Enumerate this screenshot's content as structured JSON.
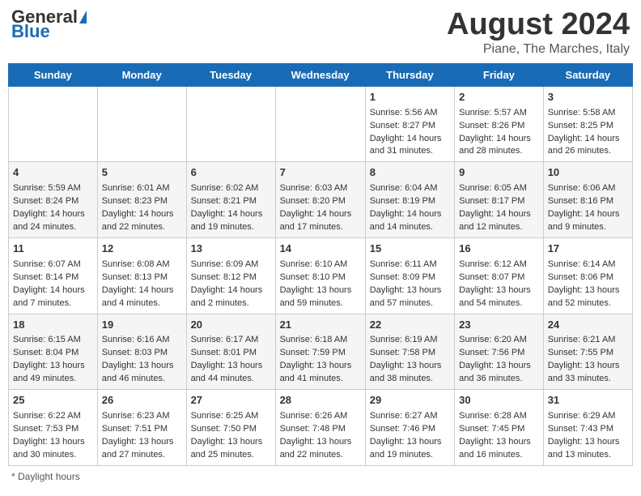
{
  "header": {
    "logo_general": "General",
    "logo_blue": "Blue",
    "month_title": "August 2024",
    "location": "Piane, The Marches, Italy"
  },
  "days_of_week": [
    "Sunday",
    "Monday",
    "Tuesday",
    "Wednesday",
    "Thursday",
    "Friday",
    "Saturday"
  ],
  "footer": {
    "daylight_label": "Daylight hours"
  },
  "weeks": [
    [
      {
        "day": "",
        "info": ""
      },
      {
        "day": "",
        "info": ""
      },
      {
        "day": "",
        "info": ""
      },
      {
        "day": "",
        "info": ""
      },
      {
        "day": "1",
        "info": "Sunrise: 5:56 AM\nSunset: 8:27 PM\nDaylight: 14 hours and 31 minutes."
      },
      {
        "day": "2",
        "info": "Sunrise: 5:57 AM\nSunset: 8:26 PM\nDaylight: 14 hours and 28 minutes."
      },
      {
        "day": "3",
        "info": "Sunrise: 5:58 AM\nSunset: 8:25 PM\nDaylight: 14 hours and 26 minutes."
      }
    ],
    [
      {
        "day": "4",
        "info": "Sunrise: 5:59 AM\nSunset: 8:24 PM\nDaylight: 14 hours and 24 minutes."
      },
      {
        "day": "5",
        "info": "Sunrise: 6:01 AM\nSunset: 8:23 PM\nDaylight: 14 hours and 22 minutes."
      },
      {
        "day": "6",
        "info": "Sunrise: 6:02 AM\nSunset: 8:21 PM\nDaylight: 14 hours and 19 minutes."
      },
      {
        "day": "7",
        "info": "Sunrise: 6:03 AM\nSunset: 8:20 PM\nDaylight: 14 hours and 17 minutes."
      },
      {
        "day": "8",
        "info": "Sunrise: 6:04 AM\nSunset: 8:19 PM\nDaylight: 14 hours and 14 minutes."
      },
      {
        "day": "9",
        "info": "Sunrise: 6:05 AM\nSunset: 8:17 PM\nDaylight: 14 hours and 12 minutes."
      },
      {
        "day": "10",
        "info": "Sunrise: 6:06 AM\nSunset: 8:16 PM\nDaylight: 14 hours and 9 minutes."
      }
    ],
    [
      {
        "day": "11",
        "info": "Sunrise: 6:07 AM\nSunset: 8:14 PM\nDaylight: 14 hours and 7 minutes."
      },
      {
        "day": "12",
        "info": "Sunrise: 6:08 AM\nSunset: 8:13 PM\nDaylight: 14 hours and 4 minutes."
      },
      {
        "day": "13",
        "info": "Sunrise: 6:09 AM\nSunset: 8:12 PM\nDaylight: 14 hours and 2 minutes."
      },
      {
        "day": "14",
        "info": "Sunrise: 6:10 AM\nSunset: 8:10 PM\nDaylight: 13 hours and 59 minutes."
      },
      {
        "day": "15",
        "info": "Sunrise: 6:11 AM\nSunset: 8:09 PM\nDaylight: 13 hours and 57 minutes."
      },
      {
        "day": "16",
        "info": "Sunrise: 6:12 AM\nSunset: 8:07 PM\nDaylight: 13 hours and 54 minutes."
      },
      {
        "day": "17",
        "info": "Sunrise: 6:14 AM\nSunset: 8:06 PM\nDaylight: 13 hours and 52 minutes."
      }
    ],
    [
      {
        "day": "18",
        "info": "Sunrise: 6:15 AM\nSunset: 8:04 PM\nDaylight: 13 hours and 49 minutes."
      },
      {
        "day": "19",
        "info": "Sunrise: 6:16 AM\nSunset: 8:03 PM\nDaylight: 13 hours and 46 minutes."
      },
      {
        "day": "20",
        "info": "Sunrise: 6:17 AM\nSunset: 8:01 PM\nDaylight: 13 hours and 44 minutes."
      },
      {
        "day": "21",
        "info": "Sunrise: 6:18 AM\nSunset: 7:59 PM\nDaylight: 13 hours and 41 minutes."
      },
      {
        "day": "22",
        "info": "Sunrise: 6:19 AM\nSunset: 7:58 PM\nDaylight: 13 hours and 38 minutes."
      },
      {
        "day": "23",
        "info": "Sunrise: 6:20 AM\nSunset: 7:56 PM\nDaylight: 13 hours and 36 minutes."
      },
      {
        "day": "24",
        "info": "Sunrise: 6:21 AM\nSunset: 7:55 PM\nDaylight: 13 hours and 33 minutes."
      }
    ],
    [
      {
        "day": "25",
        "info": "Sunrise: 6:22 AM\nSunset: 7:53 PM\nDaylight: 13 hours and 30 minutes."
      },
      {
        "day": "26",
        "info": "Sunrise: 6:23 AM\nSunset: 7:51 PM\nDaylight: 13 hours and 27 minutes."
      },
      {
        "day": "27",
        "info": "Sunrise: 6:25 AM\nSunset: 7:50 PM\nDaylight: 13 hours and 25 minutes."
      },
      {
        "day": "28",
        "info": "Sunrise: 6:26 AM\nSunset: 7:48 PM\nDaylight: 13 hours and 22 minutes."
      },
      {
        "day": "29",
        "info": "Sunrise: 6:27 AM\nSunset: 7:46 PM\nDaylight: 13 hours and 19 minutes."
      },
      {
        "day": "30",
        "info": "Sunrise: 6:28 AM\nSunset: 7:45 PM\nDaylight: 13 hours and 16 minutes."
      },
      {
        "day": "31",
        "info": "Sunrise: 6:29 AM\nSunset: 7:43 PM\nDaylight: 13 hours and 13 minutes."
      }
    ]
  ]
}
